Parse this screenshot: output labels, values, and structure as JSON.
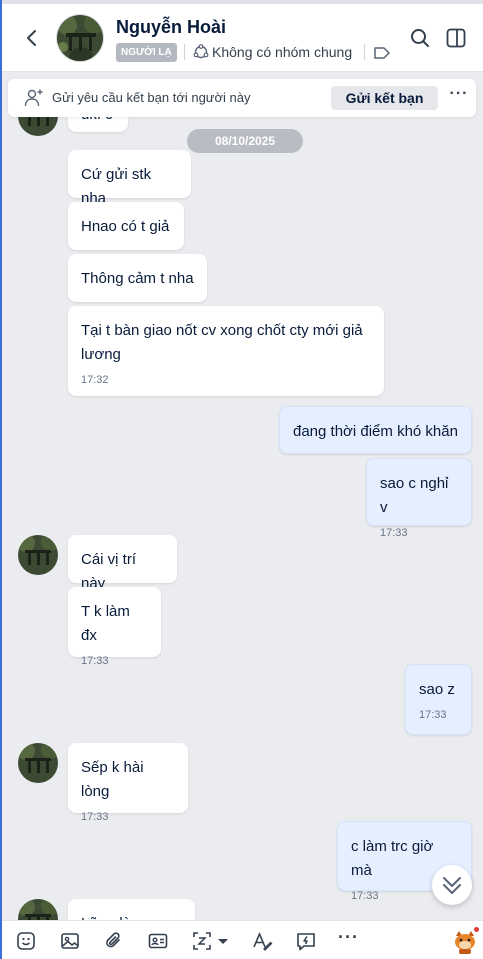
{
  "header": {
    "contact_name": "Nguyễn Hoài",
    "stranger_badge": "NGƯỜI LẠ",
    "common_group_text": "Không có nhóm chung",
    "back_icon": "chevron-left-icon",
    "search_icon": "search-icon",
    "panel_icon": "sidebar-panel-icon"
  },
  "friend_request": {
    "text": "Gửi yêu cầu kết bạn tới người này",
    "button_label": "Gửi kết bạn",
    "more_label": "···"
  },
  "chat": {
    "date_separator": "08/10/2025",
    "messages": [
      {
        "from": "them",
        "text": "ukì c"
      },
      {
        "from": "them",
        "text": "Cứ gửi stk nha"
      },
      {
        "from": "them",
        "text": "Hnao có t giả"
      },
      {
        "from": "them",
        "text": "Thông cảm t nha"
      },
      {
        "from": "them",
        "text": "Tại t bàn giao nốt cv xong chốt cty mới giả lương",
        "time": "17:32"
      },
      {
        "from": "me",
        "text": "đang thời điểm khó khăn"
      },
      {
        "from": "me",
        "text": "sao c nghỉ v",
        "time": "17:33"
      },
      {
        "from": "them",
        "text": "Cái vị trí này"
      },
      {
        "from": "them",
        "text": "T k làm đx",
        "time": "17:33"
      },
      {
        "from": "me",
        "text": "sao z",
        "time": "17:33"
      },
      {
        "from": "them",
        "text": "Sếp k hài lòng",
        "time": "17:33"
      },
      {
        "from": "me",
        "text": "c làm trc giờ mà",
        "time": "17:33"
      },
      {
        "from": "them",
        "text": "Lẽ ra là ..."
      }
    ]
  },
  "toolbar": {
    "icons": [
      "emoji-icon",
      "image-icon",
      "attachment-icon",
      "contact-card-icon",
      "screenshot-icon",
      "format-text-icon",
      "quick-message-icon",
      "more-icon",
      "sticker-icon"
    ],
    "more_label": "···"
  },
  "colors": {
    "accent": "#0068ff",
    "outgoing_bubble": "#e5efff",
    "incoming_bubble": "#ffffff",
    "chat_background": "#ebecf0"
  }
}
